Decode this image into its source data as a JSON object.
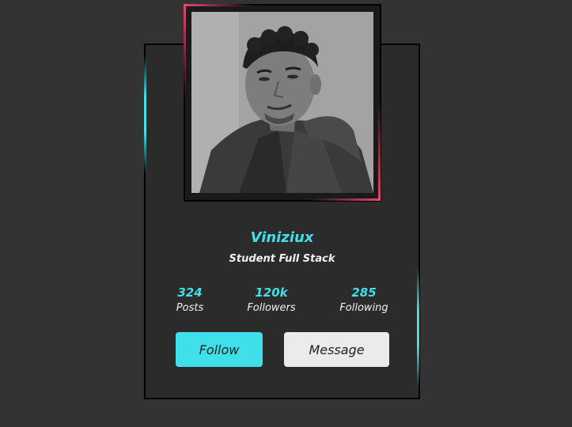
{
  "profile": {
    "name": "Viniziux",
    "role": "Student Full Stack"
  },
  "stats": [
    {
      "value": "324",
      "label": "Posts"
    },
    {
      "value": "120k",
      "label": "Followers"
    },
    {
      "value": "285",
      "label": "Following"
    }
  ],
  "actions": {
    "follow_label": "Follow",
    "message_label": "Message"
  },
  "colors": {
    "accent": "#40e0eb",
    "frame_accent": "#e9476f",
    "card_background": "#2b2b2b",
    "page_background": "#333333"
  }
}
